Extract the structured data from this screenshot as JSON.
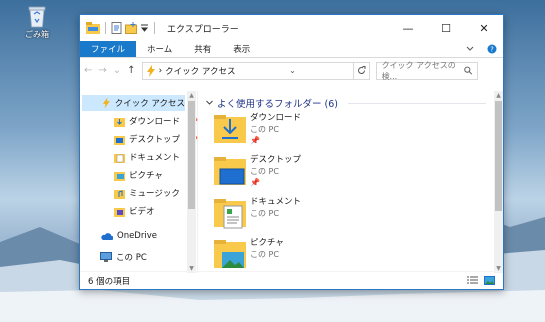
{
  "desktop": {
    "recycle_label": "ごみ箱"
  },
  "window": {
    "title": "エクスプローラー",
    "controls": {
      "minimize": "—",
      "maximize": "☐",
      "close": "✕"
    }
  },
  "ribbon": {
    "tabs": [
      "ファイル",
      "ホーム",
      "共有",
      "表示"
    ]
  },
  "address": {
    "back": "←",
    "forward": "→",
    "recent": "⌄",
    "up": "↑",
    "path": "クイック アクセス",
    "separator": "›",
    "search_placeholder": "クイック アクセスの検..."
  },
  "navpane": {
    "quick_access": "クイック アクセス",
    "items": [
      "ダウンロード",
      "デスクトップ",
      "ドキュメント",
      "ピクチャ",
      "ミュージック",
      "ビデオ"
    ],
    "onedrive": "OneDrive",
    "thispc": "この PC"
  },
  "content": {
    "group_title": "よく使用するフォルダー (6)",
    "folders": [
      {
        "name": "ダウンロード",
        "location": "この PC"
      },
      {
        "name": "デスクトップ",
        "location": "この PC"
      },
      {
        "name": "ドキュメント",
        "location": "この PC"
      },
      {
        "name": "ピクチャ",
        "location": "この PC"
      }
    ]
  },
  "status": {
    "count": "6 個の項目"
  },
  "colors": {
    "accent": "#1979ca",
    "selection": "#cce8ff",
    "group_title": "#1e3287",
    "folder": "#f8c94a"
  }
}
